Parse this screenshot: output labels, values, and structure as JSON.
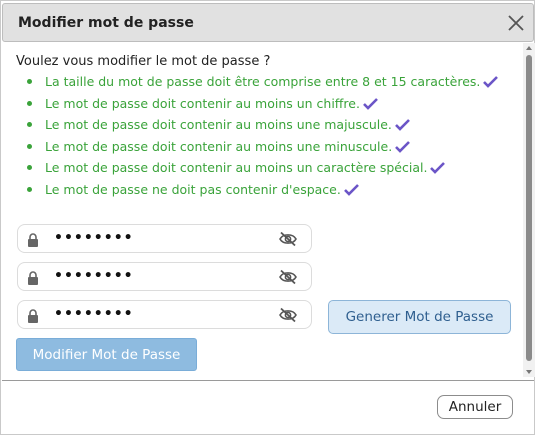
{
  "dialog": {
    "title": "Modifier mot de passe"
  },
  "content": {
    "question": "Voulez vous modifier le mot de passe ?",
    "rules": [
      "La taille du mot de passe doit être comprise entre 8 et 15 caractères.",
      "Le mot de passe doit contenir au moins un chiffre.",
      "Le mot de passe doit contenir au moins une majuscule.",
      "Le mot de passe doit contenir au moins une minuscule.",
      "Le mot de passe doit contenir au moins un caractère spécial.",
      "Le mot de passe ne doit pas contenir d'espace."
    ],
    "fields": [
      {
        "value": "••••••••"
      },
      {
        "value": "••••••••"
      },
      {
        "value": "••••••••"
      }
    ]
  },
  "buttons": {
    "generate": "Generer Mot de Passe",
    "submit": "Modifier Mot de Passe",
    "cancel": "Annuler"
  },
  "colors": {
    "rule_text": "#3aa33a",
    "check": "#6b55c7",
    "submit_bg": "#8ebbe0",
    "generate_bg": "#dbeaf7"
  },
  "icons": {
    "close": "close-icon",
    "lock": "lock-icon",
    "eye_off": "eye-off-icon",
    "check": "check-icon"
  }
}
